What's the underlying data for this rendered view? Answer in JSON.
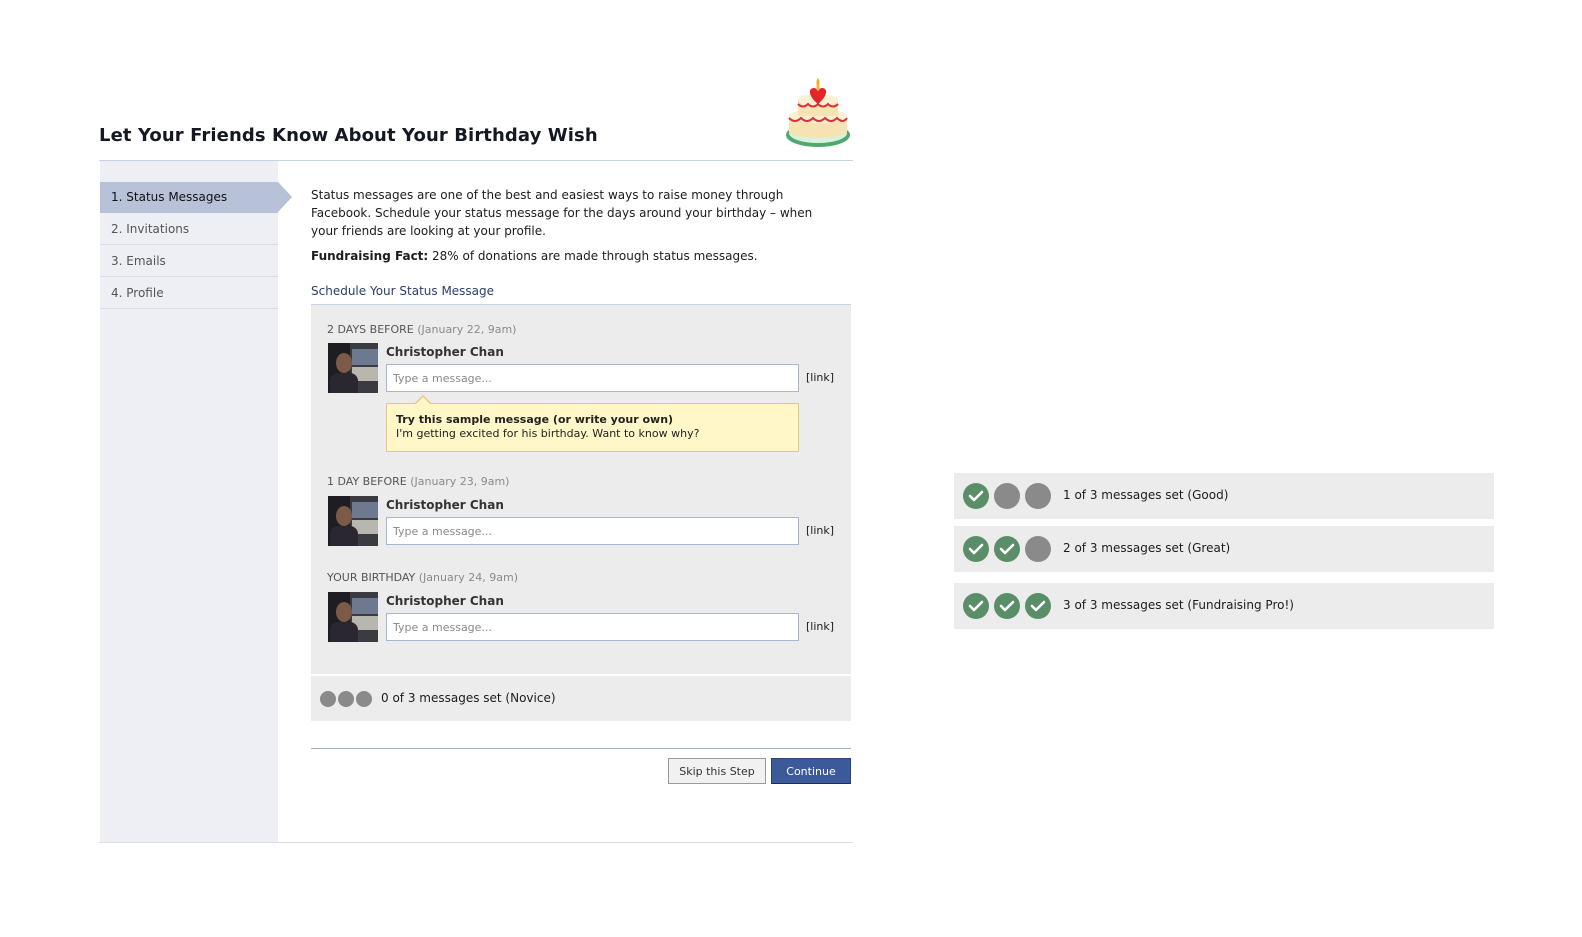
{
  "header": {
    "title": "Let Your Friends Know About Your Birthday Wish"
  },
  "sidebar": {
    "items": [
      {
        "label": "1. Status Messages",
        "active": true
      },
      {
        "label": "2. Invitations",
        "active": false
      },
      {
        "label": "3. Emails",
        "active": false
      },
      {
        "label": "4. Profile",
        "active": false
      }
    ]
  },
  "main": {
    "intro": "Status messages are one of the best and easiest ways to raise money through Facebook. Schedule your status message for the days around your birthday – when your friends are looking at your profile.",
    "fact_label": "Fundraising Fact:",
    "fact_text": " 28% of donations are made through status messages.",
    "schedule_title": "Schedule Your Status Message",
    "entries": [
      {
        "day": "2 DAYS BEFORE",
        "date": "(January 22, 9am)",
        "name": "Christopher Chan",
        "placeholder": "Type a message...",
        "link": "[link]"
      },
      {
        "day": "1 DAY BEFORE",
        "date": "(January 23, 9am)",
        "name": "Christopher Chan",
        "placeholder": "Type a message...",
        "link": "[link]"
      },
      {
        "day": "YOUR BIRTHDAY",
        "date": "(January 24, 9am)",
        "name": "Christopher Chan",
        "placeholder": "Type a message...",
        "link": "[link]"
      }
    ],
    "sample": {
      "title": "Try this sample message (or write your own)",
      "text": "I'm getting excited for his birthday. Want to know why?"
    },
    "progress": {
      "set": 0,
      "total": 3,
      "label": "0 of 3 messages set (Novice)"
    },
    "buttons": {
      "skip": "Skip this Step",
      "continue": "Continue"
    }
  },
  "states": [
    {
      "set": 1,
      "total": 3,
      "label": "1 of 3 messages set (Good)"
    },
    {
      "set": 2,
      "total": 3,
      "label": "2 of 3 messages set (Great)"
    },
    {
      "set": 3,
      "total": 3,
      "label": "3 of 3 messages set (Fundraising Pro!)"
    }
  ],
  "colors": {
    "accent": "#3c5a9a",
    "sidebar_active": "#b7c2d9",
    "check_green": "#5a8e69",
    "dot_gray": "#8a8a8a",
    "sample_bg": "#fff7c8"
  }
}
